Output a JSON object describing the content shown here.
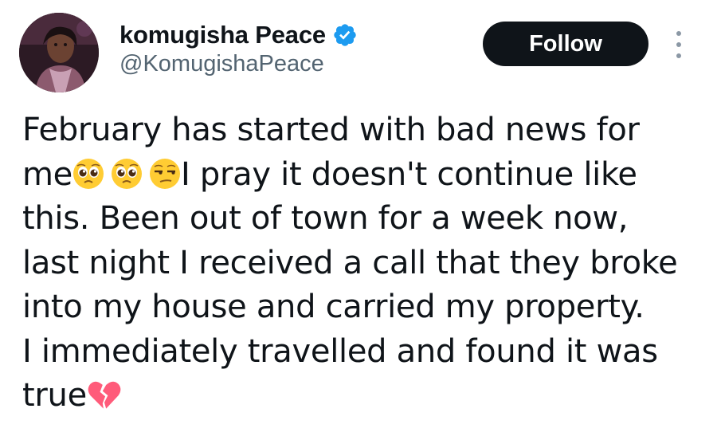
{
  "author": {
    "display_name": "komugisha Peace",
    "handle": "@KomugishaPeace",
    "verified": true
  },
  "actions": {
    "follow_label": "Follow"
  },
  "tweet": {
    "line1": "February has started with bad news for",
    "line2_before": "me",
    "line2_after": "I pray it doesn't continue like",
    "line3": "this. Been out of town for a week now,",
    "line4": "last night I received a call that they broke",
    "line5": "into my house and carried my property.",
    "line6": "I immediately travelled and found it was",
    "line7": "true",
    "emojis": [
      "pleading-face",
      "pleading-face",
      "unamused-face",
      "broken-heart"
    ]
  },
  "colors": {
    "text": "#0f1419",
    "secondary_text": "#536471",
    "verified_badge": "#1d9bf0",
    "follow_button_bg": "#0f1419",
    "follow_button_text": "#ffffff"
  }
}
